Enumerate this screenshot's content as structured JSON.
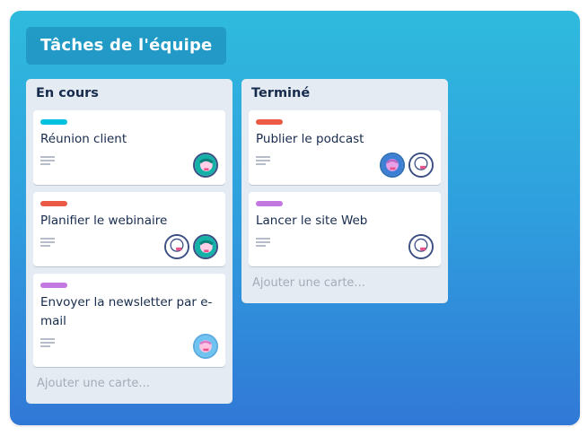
{
  "board": {
    "title": "Tâches de l'équipe"
  },
  "lists": [
    {
      "title": "En cours",
      "add_card": "Ajouter une carte...",
      "cards": [
        {
          "label_color": "#00c2e0",
          "title": "Réunion client",
          "avatars": [
            "avatar-teal"
          ]
        },
        {
          "label_color": "#eb5a46",
          "title": "Planifier le webinaire",
          "avatars": [
            "avatar-white",
            "avatar-teal"
          ]
        },
        {
          "label_color": "#c377e0",
          "title": "Envoyer la newsletter par e-mail",
          "avatars": [
            "avatar-lightblue"
          ]
        }
      ]
    },
    {
      "title": "Terminé",
      "add_card": "Ajouter une carte...",
      "cards": [
        {
          "label_color": "#eb5a46",
          "title": "Publier le podcast",
          "avatars": [
            "avatar-blue",
            "avatar-white"
          ]
        },
        {
          "label_color": "#c377e0",
          "title": "Lancer le site Web",
          "avatars": [
            "avatar-white"
          ]
        }
      ]
    }
  ],
  "icons": {
    "description": "description-lines-icon",
    "avatar": "member-avatar-icon"
  }
}
